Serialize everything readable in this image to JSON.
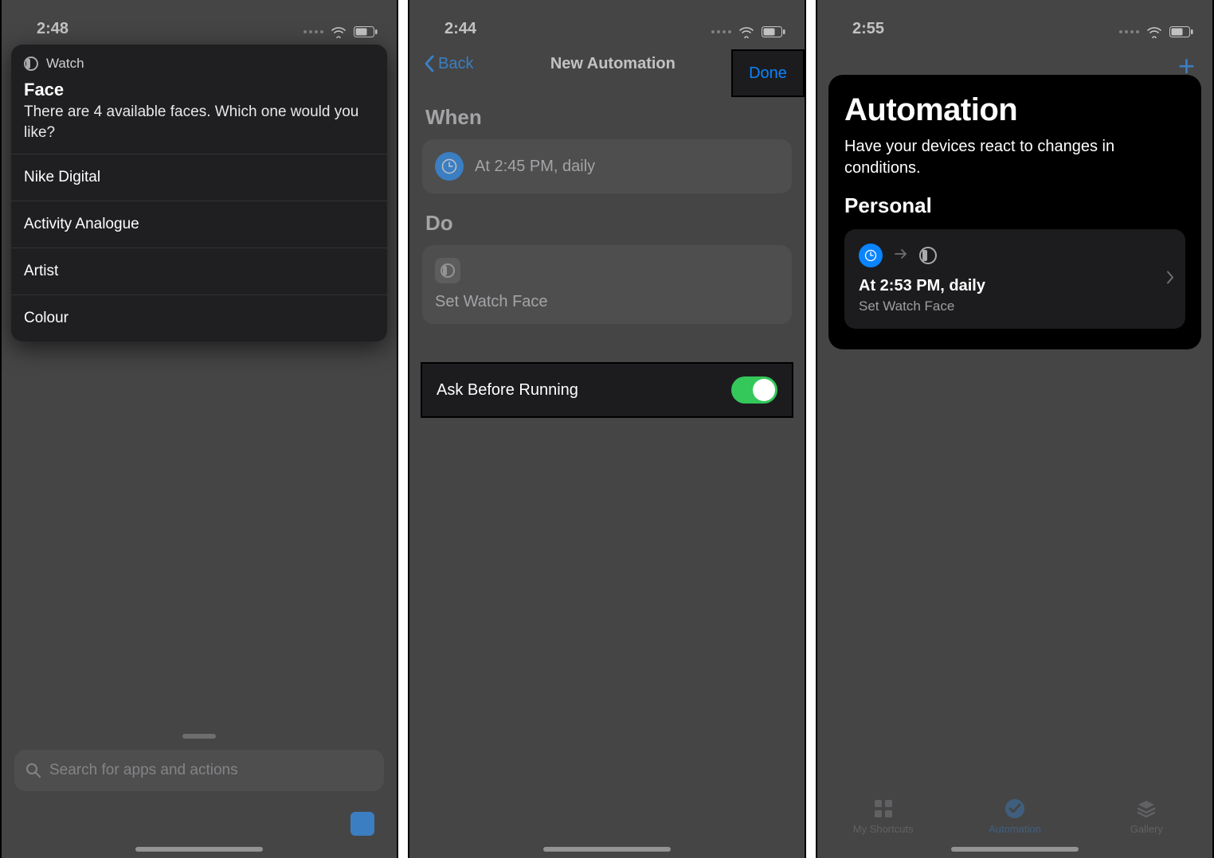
{
  "screen1": {
    "time": "2:48",
    "popup_app": "Watch",
    "popup_title": "Face",
    "popup_sub": "There are 4 available faces. Which one would you like?",
    "options": [
      "Nike Digital",
      "Activity Analogue",
      "Artist",
      "Colour"
    ],
    "search_placeholder": "Search for apps and actions"
  },
  "screen2": {
    "time": "2:44",
    "back": "Back",
    "title": "New Automation",
    "done": "Done",
    "when_heading": "When",
    "when_text": "At 2:45 PM, daily",
    "do_heading": "Do",
    "do_action": "Set Watch Face",
    "ask_label": "Ask Before Running"
  },
  "screen3": {
    "time": "2:55",
    "title": "Automation",
    "desc": "Have your devices react to changes in conditions.",
    "section": "Personal",
    "item_title": "At 2:53 PM, daily",
    "item_sub": "Set Watch Face",
    "tabs": {
      "shortcuts": "My Shortcuts",
      "automation": "Automation",
      "gallery": "Gallery"
    }
  }
}
